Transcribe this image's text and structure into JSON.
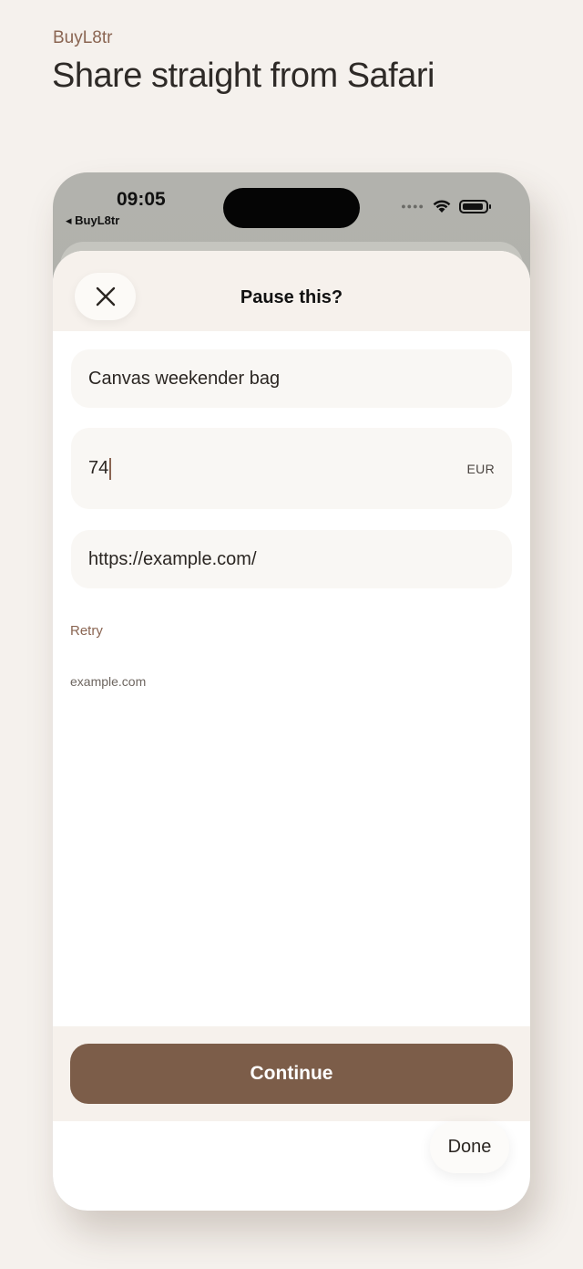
{
  "page": {
    "brand": "BuyL8tr",
    "headline": "Share straight from Safari"
  },
  "status_bar": {
    "time": "09:05",
    "back_label": "◂ BuyL8tr",
    "icons": [
      "signal-dots-icon",
      "wifi-icon",
      "battery-icon"
    ]
  },
  "sheet": {
    "title": "Pause this?",
    "close_icon": "close-icon",
    "fields": {
      "item_name": "Canvas weekender bag",
      "price": "74",
      "currency": "EUR",
      "url": "https://example.com/"
    },
    "retry_label": "Retry",
    "domain": "example.com",
    "continue_label": "Continue",
    "done_label": "Done"
  },
  "colors": {
    "background": "#f5f1ed",
    "accent": "#7c5d49",
    "brand_text": "#8a6552"
  }
}
